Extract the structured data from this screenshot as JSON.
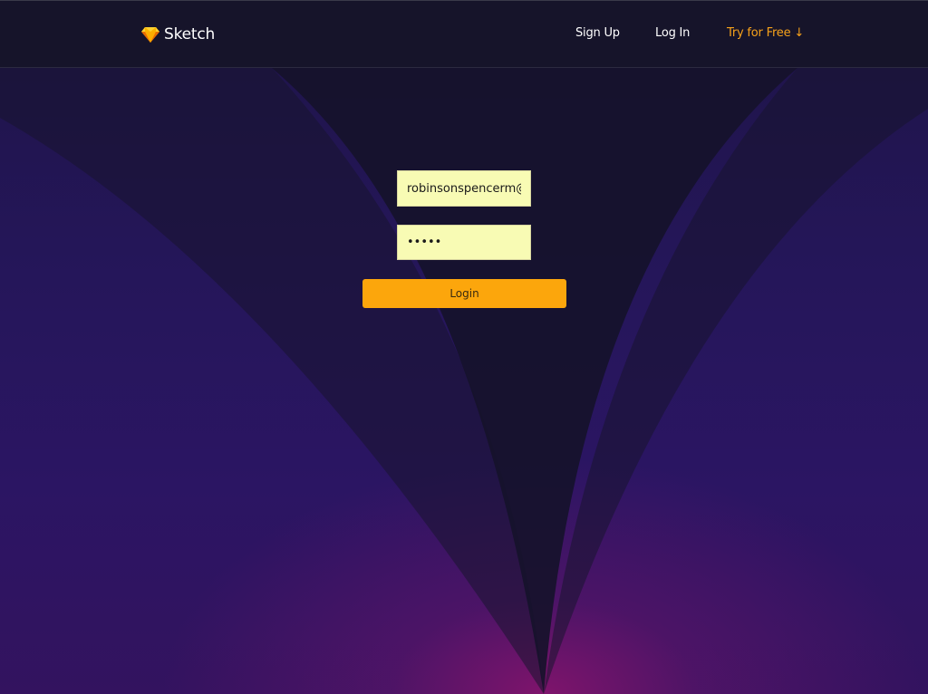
{
  "header": {
    "logo_text": "Sketch",
    "logo_icon": "diamond-icon",
    "nav": {
      "sign_up": "Sign Up",
      "log_in": "Log In",
      "try_free": "Try for Free ↓"
    }
  },
  "form": {
    "email_value": "robinsonspencerm@",
    "password_value": "•••••",
    "login_label": "Login"
  },
  "colors": {
    "accent": "#fca60c",
    "field_bg": "#f8fbb4",
    "topbar_bg": "#16142a",
    "page_bg": "#2a1660"
  }
}
